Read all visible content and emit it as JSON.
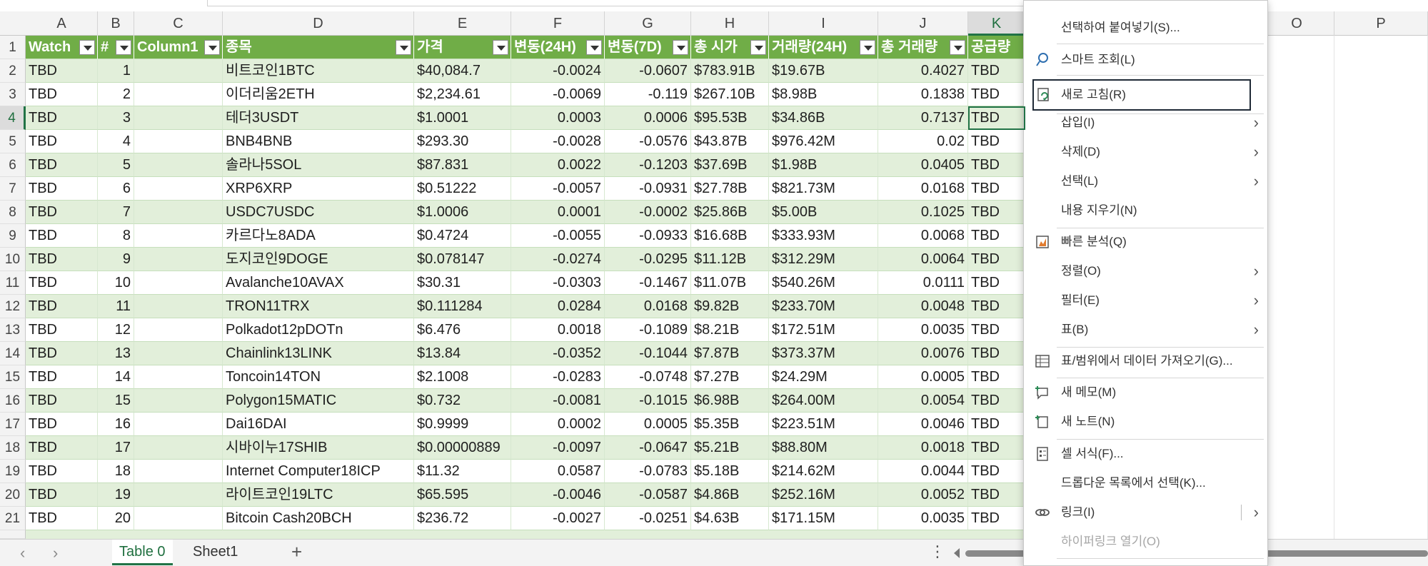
{
  "columns": [
    "A",
    "B",
    "C",
    "D",
    "E",
    "F",
    "G",
    "H",
    "I",
    "J",
    "K",
    "",
    "O",
    "P"
  ],
  "header": [
    "Watch",
    "#",
    "Column1",
    "종목",
    "가격",
    "변동(24H)",
    "변동(7D)",
    "총 시가",
    "거래량(24H)",
    "총 거래량",
    "공급량"
  ],
  "rows": [
    [
      "TBD",
      "1",
      "",
      "비트코인1BTC",
      "$40,084.7",
      "-0.0024",
      "-0.0607",
      "$783.91B",
      "$19.67B",
      "0.4027",
      "TBD"
    ],
    [
      "TBD",
      "2",
      "",
      "이더리움2ETH",
      "$2,234.61",
      "-0.0069",
      "-0.119",
      "$267.10B",
      "$8.98B",
      "0.1838",
      "TBD"
    ],
    [
      "TBD",
      "3",
      "",
      "테더3USDT",
      "$1.0001",
      "0.0003",
      "0.0006",
      "$95.53B",
      "$34.86B",
      "0.7137",
      "TBD"
    ],
    [
      "TBD",
      "4",
      "",
      "BNB4BNB",
      "$293.30",
      "-0.0028",
      "-0.0576",
      "$43.87B",
      "$976.42M",
      "0.02",
      "TBD"
    ],
    [
      "TBD",
      "5",
      "",
      "솔라나5SOL",
      "$87.831",
      "0.0022",
      "-0.1203",
      "$37.69B",
      "$1.98B",
      "0.0405",
      "TBD"
    ],
    [
      "TBD",
      "6",
      "",
      "XRP6XRP",
      "$0.51222",
      "-0.0057",
      "-0.0931",
      "$27.78B",
      "$821.73M",
      "0.0168",
      "TBD"
    ],
    [
      "TBD",
      "7",
      "",
      "USDC7USDC",
      "$1.0006",
      "0.0001",
      "-0.0002",
      "$25.86B",
      "$5.00B",
      "0.1025",
      "TBD"
    ],
    [
      "TBD",
      "8",
      "",
      "카르다노8ADA",
      "$0.4724",
      "-0.0055",
      "-0.0933",
      "$16.68B",
      "$333.93M",
      "0.0068",
      "TBD"
    ],
    [
      "TBD",
      "9",
      "",
      "도지코인9DOGE",
      "$0.078147",
      "-0.0274",
      "-0.0295",
      "$11.12B",
      "$312.29M",
      "0.0064",
      "TBD"
    ],
    [
      "TBD",
      "10",
      "",
      "Avalanche10AVAX",
      "$30.31",
      "-0.0303",
      "-0.1467",
      "$11.07B",
      "$540.26M",
      "0.0111",
      "TBD"
    ],
    [
      "TBD",
      "11",
      "",
      "TRON11TRX",
      "$0.111284",
      "0.0284",
      "0.0168",
      "$9.82B",
      "$233.70M",
      "0.0048",
      "TBD"
    ],
    [
      "TBD",
      "12",
      "",
      "Polkadot12pDOTn",
      "$6.476",
      "0.0018",
      "-0.1089",
      "$8.21B",
      "$172.51M",
      "0.0035",
      "TBD"
    ],
    [
      "TBD",
      "13",
      "",
      "Chainlink13LINK",
      "$13.84",
      "-0.0352",
      "-0.1044",
      "$7.87B",
      "$373.37M",
      "0.0076",
      "TBD"
    ],
    [
      "TBD",
      "14",
      "",
      "Toncoin14TON",
      "$2.1008",
      "-0.0283",
      "-0.0748",
      "$7.27B",
      "$24.29M",
      "0.0005",
      "TBD"
    ],
    [
      "TBD",
      "15",
      "",
      "Polygon15MATIC",
      "$0.732",
      "-0.0081",
      "-0.1015",
      "$6.98B",
      "$264.00M",
      "0.0054",
      "TBD"
    ],
    [
      "TBD",
      "16",
      "",
      "Dai16DAI",
      "$0.9999",
      "0.0002",
      "0.0005",
      "$5.35B",
      "$223.51M",
      "0.0046",
      "TBD"
    ],
    [
      "TBD",
      "17",
      "",
      "시바이누17SHIB",
      "$0.00000889",
      "-0.0097",
      "-0.0647",
      "$5.21B",
      "$88.80M",
      "0.0018",
      "TBD"
    ],
    [
      "TBD",
      "18",
      "",
      "Internet Computer18ICP",
      "$11.32",
      "0.0587",
      "-0.0783",
      "$5.18B",
      "$214.62M",
      "0.0044",
      "TBD"
    ],
    [
      "TBD",
      "19",
      "",
      "라이트코인19LTC",
      "$65.595",
      "-0.0046",
      "-0.0587",
      "$4.86B",
      "$252.16M",
      "0.0052",
      "TBD"
    ],
    [
      "TBD",
      "20",
      "",
      "Bitcoin Cash20BCH",
      "$236.72",
      "-0.0027",
      "-0.0251",
      "$4.63B",
      "$171.15M",
      "0.0035",
      "TBD"
    ]
  ],
  "row_numbers": [
    "1",
    "2",
    "3",
    "4",
    "5",
    "6",
    "7",
    "8",
    "9",
    "10",
    "11",
    "12",
    "13",
    "14",
    "15",
    "16",
    "17",
    "18",
    "19",
    "20",
    "21"
  ],
  "sheet_tabs": [
    "Table 0",
    "Sheet1"
  ],
  "add_sheet_label": "+",
  "context_menu": {
    "paste_special": "선택하여 붙여넣기(S)...",
    "smart_lookup": "스마트 조회(L)",
    "refresh": "새로 고침(R)",
    "insert": "삽입(I)",
    "delete": "삭제(D)",
    "select": "선택(L)",
    "clear_contents": "내용 지우기(N)",
    "quick_analysis": "빠른 분석(Q)",
    "sort": "정렬(O)",
    "filter": "필터(E)",
    "table": "표(B)",
    "get_data": "표/범위에서 데이터 가져오기(G)...",
    "new_comment": "새 메모(M)",
    "new_note": "새 노트(N)",
    "format_cells": "셀 서식(F)...",
    "pick_dropdown": "드롭다운 목록에서 선택(K)...",
    "link": "링크(I)",
    "open_hyperlink": "하이퍼링크 열기(O)"
  },
  "colors": {
    "header_green": "#70ad47",
    "band_green": "#e2efda",
    "accent": "#217346"
  }
}
